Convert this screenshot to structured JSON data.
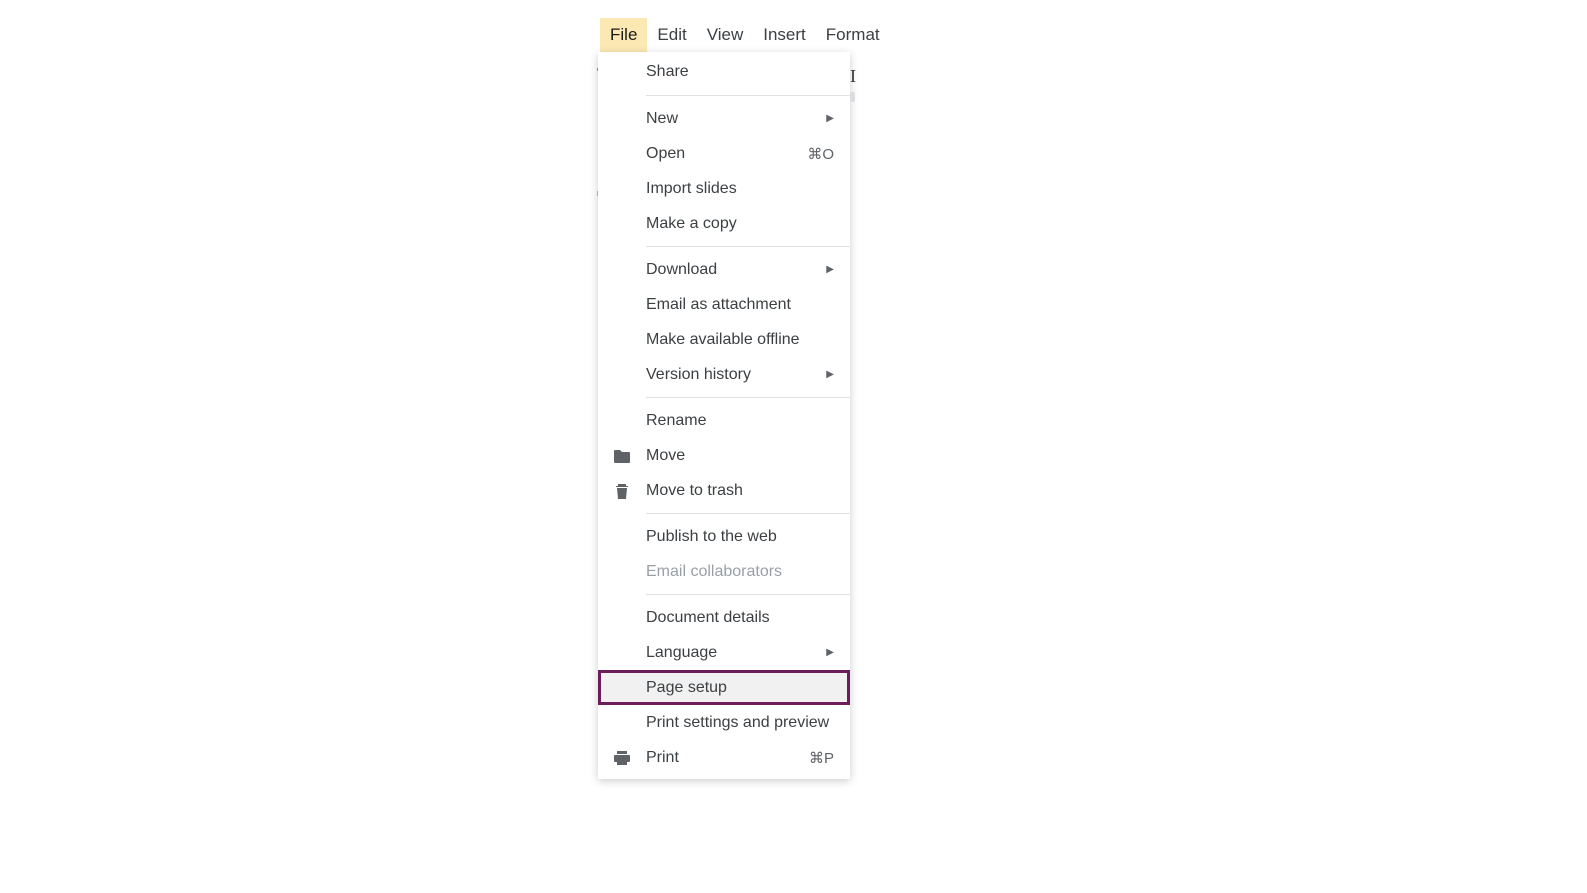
{
  "menubar": {
    "items": [
      {
        "label": "File",
        "active": true
      },
      {
        "label": "Edit",
        "active": false
      },
      {
        "label": "View",
        "active": false
      },
      {
        "label": "Insert",
        "active": false
      },
      {
        "label": "Format",
        "active": false
      }
    ]
  },
  "dropdown": {
    "groups": [
      [
        {
          "label": "Share",
          "icon": null,
          "shortcut": null,
          "submenu": false
        }
      ],
      [
        {
          "label": "New",
          "icon": null,
          "shortcut": null,
          "submenu": true
        },
        {
          "label": "Open",
          "icon": null,
          "shortcut": "⌘O",
          "submenu": false
        },
        {
          "label": "Import slides",
          "icon": null,
          "shortcut": null,
          "submenu": false
        },
        {
          "label": "Make a copy",
          "icon": null,
          "shortcut": null,
          "submenu": false
        }
      ],
      [
        {
          "label": "Download",
          "icon": null,
          "shortcut": null,
          "submenu": true
        },
        {
          "label": "Email as attachment",
          "icon": null,
          "shortcut": null,
          "submenu": false
        },
        {
          "label": "Make available offline",
          "icon": null,
          "shortcut": null,
          "submenu": false
        },
        {
          "label": "Version history",
          "icon": null,
          "shortcut": null,
          "submenu": true
        }
      ],
      [
        {
          "label": "Rename",
          "icon": null,
          "shortcut": null,
          "submenu": false
        },
        {
          "label": "Move",
          "icon": "folder",
          "shortcut": null,
          "submenu": false
        },
        {
          "label": "Move to trash",
          "icon": "trash",
          "shortcut": null,
          "submenu": false
        }
      ],
      [
        {
          "label": "Publish to the web",
          "icon": null,
          "shortcut": null,
          "submenu": false
        },
        {
          "label": "Email collaborators",
          "icon": null,
          "shortcut": null,
          "submenu": false,
          "disabled": true
        }
      ],
      [
        {
          "label": "Document details",
          "icon": null,
          "shortcut": null,
          "submenu": false
        },
        {
          "label": "Language",
          "icon": null,
          "shortcut": null,
          "submenu": true
        },
        {
          "label": "Page setup",
          "icon": null,
          "shortcut": null,
          "submenu": false,
          "highlighted": true
        },
        {
          "label": "Print settings and preview",
          "icon": null,
          "shortcut": null,
          "submenu": false
        },
        {
          "label": "Print",
          "icon": "print",
          "shortcut": "⌘P",
          "submenu": false
        }
      ]
    ]
  }
}
